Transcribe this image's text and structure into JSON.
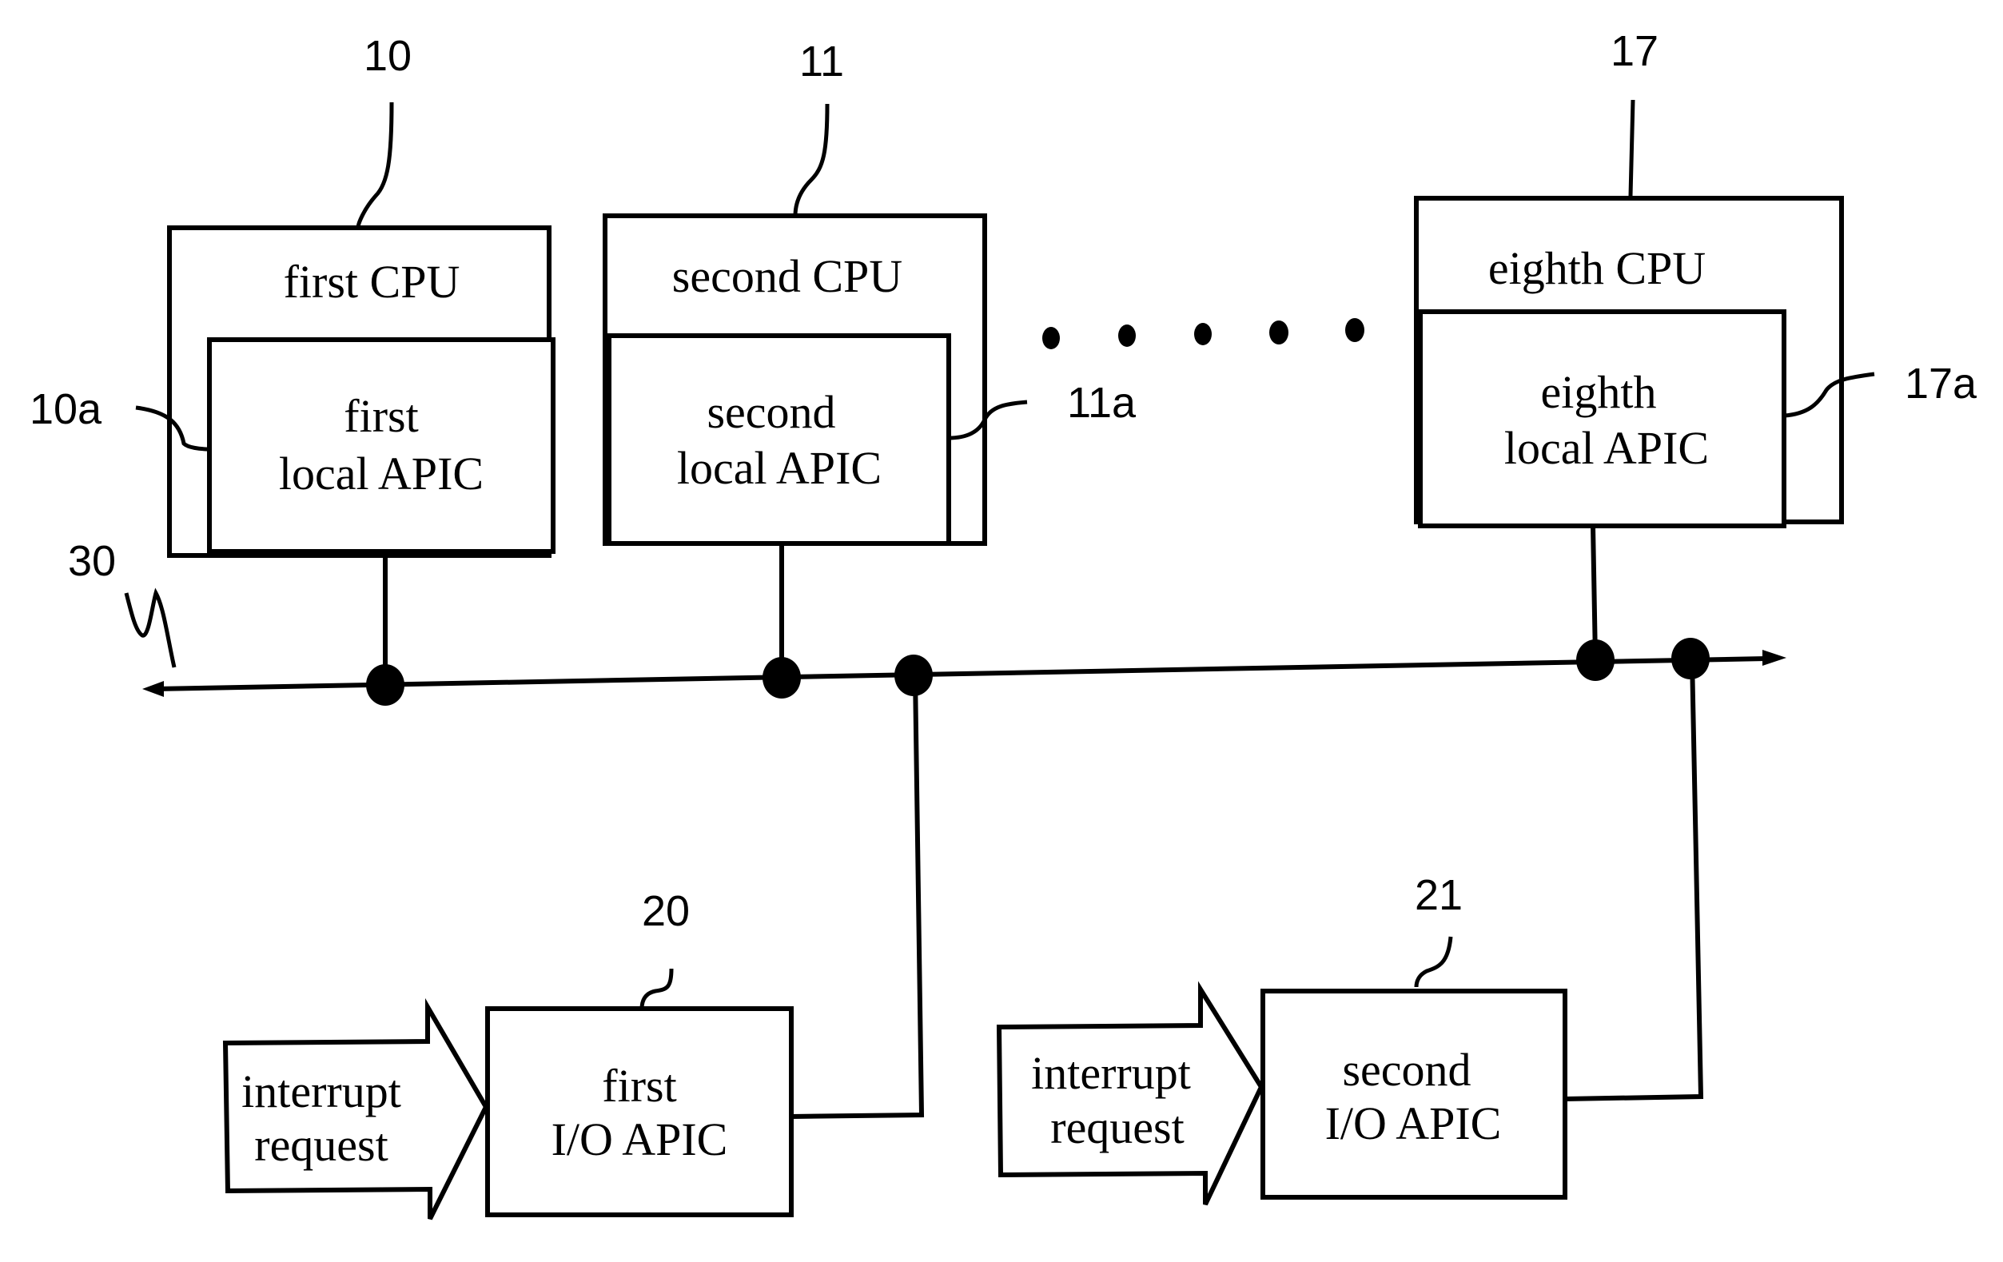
{
  "diagram": {
    "cpus": [
      {
        "ref": "10",
        "title": "first CPU",
        "apic_ref": "10a",
        "apic_line1": "first",
        "apic_line2": "local APIC"
      },
      {
        "ref": "11",
        "title": "second CPU",
        "apic_ref": "11a",
        "apic_line1": "second",
        "apic_line2": "local APIC"
      },
      {
        "ref": "17",
        "title": "eighth CPU",
        "apic_ref": "17a",
        "apic_line1": "eighth",
        "apic_line2": "local APIC"
      }
    ],
    "bus_ref": "30",
    "io_apics": [
      {
        "ref": "20",
        "line1": "first",
        "line2": "I/O APIC",
        "input_line1": "interrupt",
        "input_line2": "request"
      },
      {
        "ref": "21",
        "line1": "second",
        "line2": "I/O APIC",
        "input_line1": "interrupt",
        "input_line2": "request"
      }
    ],
    "ellipsis_dots": 5
  }
}
